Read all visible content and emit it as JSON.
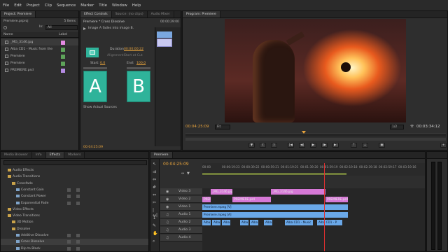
{
  "menubar": [
    "File",
    "Edit",
    "Project",
    "Clip",
    "Sequence",
    "Marker",
    "Title",
    "Window",
    "Help"
  ],
  "project_panel": {
    "tabs": [
      "Project: Premiere",
      "Media Browser"
    ],
    "project_name": "Premiere.prproj",
    "item_count": "5 Items",
    "in_label": "In:",
    "in_value": "All",
    "col_name": "Name",
    "col_label": "Label",
    "items": [
      {
        "name": "_MG_3146.jpg",
        "color": "#e58be3"
      },
      {
        "name": "Alba CD1 - Music from the",
        "color": "#5ea35a"
      },
      {
        "name": "Premiere",
        "color": "#5ea35a"
      },
      {
        "name": "Premiere",
        "color": "#5ea35a"
      },
      {
        "name": "PREMIERE.psd",
        "color": "#b58be3"
      }
    ]
  },
  "effect_controls": {
    "tabs": [
      "Effect Controls",
      "Source: (no clips)",
      "Audio Mixer"
    ],
    "header": "Premiere * Cross Dissolve",
    "timecode": "00:00:29:00",
    "description": "Image A fades into image B.",
    "duration_label": "Duration",
    "duration_value": "00:00:00:22",
    "alignment_label": "Alignment:",
    "alignment_value": "Start at Cut",
    "start_label": "Start:",
    "start_value": "0.0",
    "end_label": "End:",
    "end_value": "100.0",
    "a_label": "A",
    "b_label": "B",
    "show_sources": "Show Actual Sources",
    "footer_timecode": "00:04:25:09"
  },
  "program_monitor": {
    "tab": "Program: Premiere",
    "current_time": "00:04:25:09",
    "fit": "Fit",
    "resolution": "1/2",
    "duration": "00:03:34:12"
  },
  "effects_panel": {
    "tabs": [
      "Media Browser",
      "Info",
      "Effects",
      "Markers"
    ],
    "items": [
      {
        "label": "Audio Effects",
        "indent": 1
      },
      {
        "label": "Audio Transitions",
        "indent": 1
      },
      {
        "label": "Crossfade",
        "indent": 2
      },
      {
        "label": "Constant Gain",
        "indent": 3
      },
      {
        "label": "Constant Power",
        "indent": 3
      },
      {
        "label": "Exponential Fade",
        "indent": 3
      },
      {
        "label": "Video Effects",
        "indent": 1
      },
      {
        "label": "Video Transitions",
        "indent": 1
      },
      {
        "label": "3D Motion",
        "indent": 2
      },
      {
        "label": "Dissolve",
        "indent": 2
      },
      {
        "label": "Additive Dissolve",
        "indent": 3
      },
      {
        "label": "Cross Dissolve",
        "indent": 3
      },
      {
        "label": "Dip to Black",
        "indent": 3
      }
    ]
  },
  "timeline": {
    "tab": "Premiere",
    "timecode": "00:04:25:09",
    "ticks": [
      "00:00:20:00",
      "00:00:30:00",
      "00:00:40:00",
      "00:00:50:00",
      "00:01:00:00",
      "00:01:10:00",
      "00:01:20:00",
      "00:01:30:00",
      "00:01:40:00",
      "00:01:50:00",
      "00:02:00:00"
    ],
    "ticks_display": [
      "00:00",
      "00:00:19:23",
      "00:00:39:22",
      "00:00:59:21",
      "00:01:19:21",
      "00:01:39:20",
      "00:01:59:19",
      "00:02:19:18",
      "00:02:39:18",
      "00:02:59:17",
      "00:03:19:16"
    ],
    "tracks": [
      {
        "name": "Video 3",
        "type": "video"
      },
      {
        "name": "Video 2",
        "type": "video"
      },
      {
        "name": "Video 1",
        "type": "video"
      },
      {
        "name": "Audio 1",
        "type": "audio"
      },
      {
        "name": "Audio 2",
        "type": "audio"
      },
      {
        "name": "Audio 3",
        "type": "audio"
      },
      {
        "name": "Audio 4",
        "type": "audio"
      }
    ],
    "clips": {
      "v3_a": "_MG_3146.jpg",
      "v3_b": "_MG_3146.jpg",
      "v2_a": "PREM",
      "v2_b": "PREMIERE.psd",
      "v2_c": "PREMIERE.psd",
      "v1_a": "Premiere.mpeg [V]",
      "a1_a": "Premiere.mpeg [A]",
      "a2": [
        "Alba",
        "Alba",
        "Alba",
        "Alba",
        "Alba",
        "Alba",
        "Alba CD1 - Music",
        "Alba CD1 - P"
      ]
    }
  },
  "colors": {
    "accent": "#e6a23c",
    "timecode_orange": "#e6a23c",
    "clip_pink": "#d678d6",
    "clip_blue": "#6aa8e8",
    "tile_teal": "#2fb39a"
  }
}
